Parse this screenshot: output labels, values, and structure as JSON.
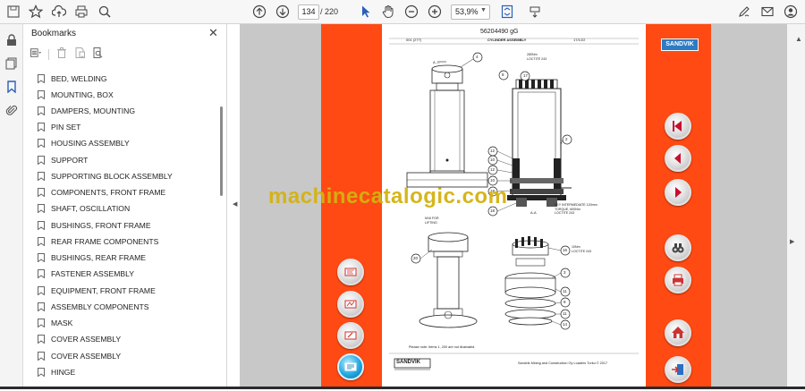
{
  "toolbar": {
    "page_current": "134",
    "page_total": "/ 220",
    "zoom": "53,9%"
  },
  "bookmarks_panel": {
    "title": "Bookmarks",
    "items": [
      "BED, WELDING",
      "MOUNTING, BOX",
      "DAMPERS, MOUNTING",
      "PIN SET",
      "HOUSING ASSEMBLY",
      "SUPPORT",
      "SUPPORTING BLOCK ASSEMBLY",
      "COMPONENTS, FRONT FRAME",
      "SHAFT, OSCILLATION",
      "BUSHINGS, FRONT FRAME",
      "REAR FRAME COMPONENTS",
      "BUSHINGS, REAR FRAME",
      "FASTENER ASSEMBLY",
      "EQUIPMENT, FRONT FRAME",
      "ASSEMBLY COMPONENTS",
      "MASK",
      "COVER ASSEMBLY",
      "COVER ASSEMBLY",
      "HINGE"
    ]
  },
  "document": {
    "part_number": "56204490 gG",
    "header_left": "001 (277)",
    "header_title": "CYLINDER ASSEMBLY",
    "header_right": "17/1/22",
    "note": "Please note: Items 1, 200 are not illustrated.",
    "footer_brand": "SANDVIK",
    "footer_text": "Sandvik Mining and Construction Oy Loaders Turku © 2017",
    "logo": "SANDVIK",
    "section_label": "A —",
    "section_aa": "A-A",
    "callouts_top": [
      "4",
      "17",
      "8",
      "2",
      "12",
      "10",
      "12",
      "10",
      "18",
      "18"
    ],
    "callouts_bottom": [
      "20",
      "16",
      "3",
      "11",
      "9",
      "11",
      "14"
    ],
    "annotation_17": "280Nm\nLOCTITE 243",
    "annotation_key": "KEY INTERMEDIATE 120mm\nTORQUE, 600Nm\nLOCTITE 243",
    "annotation_m16": "M16 FOR\nLIFTING",
    "annotation_16": "10Nm\nLOCTITE 243"
  },
  "watermark": "machinecatalogic.com",
  "colors": {
    "accent_orange": "#ff4a14",
    "nav_button_active": "#22a8e0",
    "watermark": "#d4b210"
  }
}
